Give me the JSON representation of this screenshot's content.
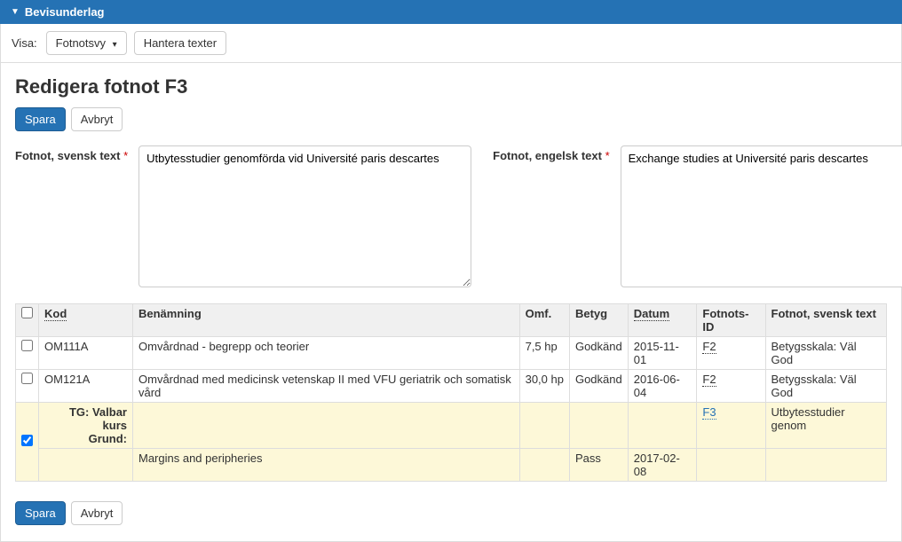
{
  "panel": {
    "title": "Bevisunderlag"
  },
  "toolbar": {
    "visa_label": "Visa:",
    "dropdown_label": "Fotnotsvy",
    "hantera_label": "Hantera texter"
  },
  "page": {
    "title": "Redigera fotnot F3"
  },
  "buttons": {
    "save": "Spara",
    "cancel": "Avbryt"
  },
  "form": {
    "sv_label": "Fotnot, svensk text",
    "en_label": "Fotnot, engelsk text",
    "sv_value": "Utbytesstudier genomförda vid Université paris descartes",
    "en_value": "Exchange studies at Université paris descartes"
  },
  "table": {
    "headers": {
      "kod": "Kod",
      "benamning": "Benämning",
      "omf": "Omf.",
      "betyg": "Betyg",
      "datum": "Datum",
      "fotnots_id": "Fotnots-ID",
      "fotnot_sv": "Fotnot, svensk text"
    },
    "rows": [
      {
        "checked": false,
        "kod": "OM111A",
        "benamning": "Omvårdnad - begrepp och teorier",
        "omf": "7,5 hp",
        "betyg": "Godkänd",
        "datum": "2015-11-01",
        "fotnots_id": "F2",
        "fotnot_sv": "Betygsskala: Väl God"
      },
      {
        "checked": false,
        "kod": "OM121A",
        "benamning": "Omvårdnad med medicinsk vetenskap II med VFU geriatrik och somatisk vård",
        "omf": "30,0 hp",
        "betyg": "Godkänd",
        "datum": "2016-06-04",
        "fotnots_id": "F2",
        "fotnot_sv": "Betygsskala: Väl God"
      }
    ],
    "tg": {
      "checked": true,
      "label_line1": "TG: Valbar kurs",
      "label_line2": "Grund:",
      "benamning": "Margins and peripheries",
      "betyg": "Pass",
      "datum": "2017-02-08",
      "fotnots_id": "F3",
      "fotnot_sv": "Utbytesstudier genom"
    }
  }
}
